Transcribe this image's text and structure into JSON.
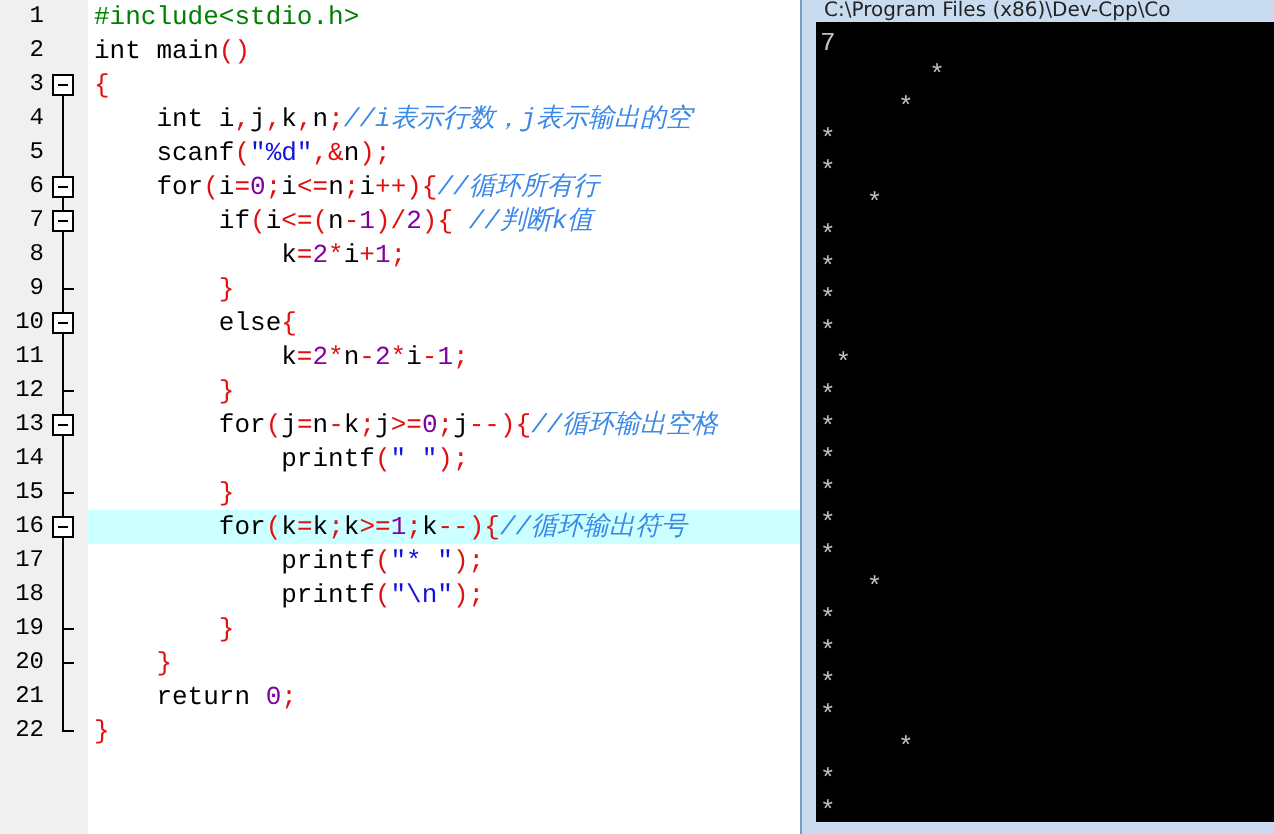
{
  "editor": {
    "lines": [
      {
        "number": "1",
        "kind": "line",
        "current": false,
        "segments": [
          {
            "kind": "pre",
            "text": "#include<stdio.h>"
          }
        ]
      },
      {
        "number": "2",
        "kind": "line",
        "current": false,
        "segments": [
          {
            "kind": "plain",
            "text": "int main"
          },
          {
            "kind": "sym",
            "text": "()"
          }
        ]
      },
      {
        "number": "3",
        "kind": "block_start",
        "current": false,
        "segments": [
          {
            "kind": "sym",
            "text": "{"
          }
        ]
      },
      {
        "number": "4",
        "kind": "line",
        "current": false,
        "segments": [
          {
            "kind": "plain",
            "text": "    int i"
          },
          {
            "kind": "sym",
            "text": ","
          },
          {
            "kind": "plain",
            "text": "j"
          },
          {
            "kind": "sym",
            "text": ","
          },
          {
            "kind": "plain",
            "text": "k"
          },
          {
            "kind": "sym",
            "text": ","
          },
          {
            "kind": "plain",
            "text": "n"
          },
          {
            "kind": "sym",
            "text": ";"
          },
          {
            "kind": "comment",
            "text": "//i表示行数，j表示输出的空"
          }
        ]
      },
      {
        "number": "5",
        "kind": "line",
        "current": false,
        "segments": [
          {
            "kind": "plain",
            "text": "    scanf"
          },
          {
            "kind": "sym",
            "text": "("
          },
          {
            "kind": "str",
            "text": "\"%d\""
          },
          {
            "kind": "sym",
            "text": ",&"
          },
          {
            "kind": "plain",
            "text": "n"
          },
          {
            "kind": "sym",
            "text": ");"
          }
        ]
      },
      {
        "number": "6",
        "kind": "block_start",
        "current": false,
        "segments": [
          {
            "kind": "plain",
            "text": "    for"
          },
          {
            "kind": "sym",
            "text": "("
          },
          {
            "kind": "plain",
            "text": "i"
          },
          {
            "kind": "sym",
            "text": "="
          },
          {
            "kind": "num",
            "text": "0"
          },
          {
            "kind": "sym",
            "text": ";"
          },
          {
            "kind": "plain",
            "text": "i"
          },
          {
            "kind": "sym",
            "text": "<="
          },
          {
            "kind": "plain",
            "text": "n"
          },
          {
            "kind": "sym",
            "text": ";"
          },
          {
            "kind": "plain",
            "text": "i"
          },
          {
            "kind": "sym",
            "text": "++){"
          },
          {
            "kind": "comment",
            "text": "//循环所有行"
          }
        ]
      },
      {
        "number": "7",
        "kind": "block_start",
        "current": false,
        "segments": [
          {
            "kind": "plain",
            "text": "        if"
          },
          {
            "kind": "sym",
            "text": "("
          },
          {
            "kind": "plain",
            "text": "i"
          },
          {
            "kind": "sym",
            "text": "<=("
          },
          {
            "kind": "plain",
            "text": "n"
          },
          {
            "kind": "sym",
            "text": "-"
          },
          {
            "kind": "num",
            "text": "1"
          },
          {
            "kind": "sym",
            "text": ")/"
          },
          {
            "kind": "num",
            "text": "2"
          },
          {
            "kind": "sym",
            "text": "){ "
          },
          {
            "kind": "comment",
            "text": "//判断k值"
          }
        ]
      },
      {
        "number": "8",
        "kind": "line",
        "current": false,
        "segments": [
          {
            "kind": "plain",
            "text": "            k"
          },
          {
            "kind": "sym",
            "text": "="
          },
          {
            "kind": "num",
            "text": "2"
          },
          {
            "kind": "sym",
            "text": "*"
          },
          {
            "kind": "plain",
            "text": "i"
          },
          {
            "kind": "sym",
            "text": "+"
          },
          {
            "kind": "num",
            "text": "1"
          },
          {
            "kind": "sym",
            "text": ";"
          }
        ]
      },
      {
        "number": "9",
        "kind": "block_end",
        "current": false,
        "segments": [
          {
            "kind": "sym",
            "text": "        }"
          }
        ]
      },
      {
        "number": "10",
        "kind": "block_start",
        "current": false,
        "segments": [
          {
            "kind": "plain",
            "text": "        else"
          },
          {
            "kind": "sym",
            "text": "{"
          }
        ]
      },
      {
        "number": "11",
        "kind": "line",
        "current": false,
        "segments": [
          {
            "kind": "plain",
            "text": "            k"
          },
          {
            "kind": "sym",
            "text": "="
          },
          {
            "kind": "num",
            "text": "2"
          },
          {
            "kind": "sym",
            "text": "*"
          },
          {
            "kind": "plain",
            "text": "n"
          },
          {
            "kind": "sym",
            "text": "-"
          },
          {
            "kind": "num",
            "text": "2"
          },
          {
            "kind": "sym",
            "text": "*"
          },
          {
            "kind": "plain",
            "text": "i"
          },
          {
            "kind": "sym",
            "text": "-"
          },
          {
            "kind": "num",
            "text": "1"
          },
          {
            "kind": "sym",
            "text": ";"
          }
        ]
      },
      {
        "number": "12",
        "kind": "block_end",
        "current": false,
        "segments": [
          {
            "kind": "sym",
            "text": "        }"
          }
        ]
      },
      {
        "number": "13",
        "kind": "block_start",
        "current": false,
        "segments": [
          {
            "kind": "plain",
            "text": "        for"
          },
          {
            "kind": "sym",
            "text": "("
          },
          {
            "kind": "plain",
            "text": "j"
          },
          {
            "kind": "sym",
            "text": "="
          },
          {
            "kind": "plain",
            "text": "n"
          },
          {
            "kind": "sym",
            "text": "-"
          },
          {
            "kind": "plain",
            "text": "k"
          },
          {
            "kind": "sym",
            "text": ";"
          },
          {
            "kind": "plain",
            "text": "j"
          },
          {
            "kind": "sym",
            "text": ">="
          },
          {
            "kind": "num",
            "text": "0"
          },
          {
            "kind": "sym",
            "text": ";"
          },
          {
            "kind": "plain",
            "text": "j"
          },
          {
            "kind": "sym",
            "text": "--){"
          },
          {
            "kind": "comment",
            "text": "//循环输出空格"
          }
        ]
      },
      {
        "number": "14",
        "kind": "line",
        "current": false,
        "segments": [
          {
            "kind": "plain",
            "text": "            printf"
          },
          {
            "kind": "sym",
            "text": "("
          },
          {
            "kind": "str",
            "text": "\" \""
          },
          {
            "kind": "sym",
            "text": ");"
          }
        ]
      },
      {
        "number": "15",
        "kind": "block_end",
        "current": false,
        "segments": [
          {
            "kind": "sym",
            "text": "        }"
          }
        ]
      },
      {
        "number": "16",
        "kind": "block_start",
        "current": true,
        "segments": [
          {
            "kind": "plain",
            "text": "        for"
          },
          {
            "kind": "sym",
            "text": "("
          },
          {
            "kind": "plain",
            "text": "k"
          },
          {
            "kind": "sym",
            "text": "="
          },
          {
            "kind": "plain",
            "text": "k"
          },
          {
            "kind": "sym",
            "text": ";"
          },
          {
            "kind": "plain",
            "text": "k"
          },
          {
            "kind": "sym",
            "text": ">="
          },
          {
            "kind": "num",
            "text": "1"
          },
          {
            "kind": "sym",
            "text": ";"
          },
          {
            "kind": "plain",
            "text": "k"
          },
          {
            "kind": "sym",
            "text": "--){"
          },
          {
            "kind": "comment",
            "text": "//循环输出符号"
          }
        ]
      },
      {
        "number": "17",
        "kind": "line",
        "current": false,
        "segments": [
          {
            "kind": "plain",
            "text": "            printf"
          },
          {
            "kind": "sym",
            "text": "("
          },
          {
            "kind": "str",
            "text": "\"* \""
          },
          {
            "kind": "sym",
            "text": ");"
          }
        ]
      },
      {
        "number": "18",
        "kind": "line",
        "current": false,
        "segments": [
          {
            "kind": "plain",
            "text": "            printf"
          },
          {
            "kind": "sym",
            "text": "("
          },
          {
            "kind": "str",
            "text": "\"\\n\""
          },
          {
            "kind": "sym",
            "text": ");"
          }
        ]
      },
      {
        "number": "19",
        "kind": "block_end",
        "current": false,
        "segments": [
          {
            "kind": "sym",
            "text": "        }"
          }
        ]
      },
      {
        "number": "20",
        "kind": "block_end",
        "current": false,
        "segments": [
          {
            "kind": "sym",
            "text": "    }"
          }
        ]
      },
      {
        "number": "21",
        "kind": "line",
        "current": false,
        "segments": [
          {
            "kind": "plain",
            "text": "    return "
          },
          {
            "kind": "num",
            "text": "0"
          },
          {
            "kind": "sym",
            "text": ";"
          }
        ]
      },
      {
        "number": "22",
        "kind": "block_end",
        "current": false,
        "segments": [
          {
            "kind": "sym",
            "text": "}"
          }
        ]
      }
    ]
  },
  "console": {
    "title": "C:\\Program Files (x86)\\Dev-Cpp\\Co",
    "lines": [
      "7",
      "       *",
      "     *",
      "*",
      "*",
      "   *",
      "*",
      "*",
      "*",
      "*",
      " *",
      "*",
      "*",
      "*",
      "*",
      "*",
      "*",
      "   *",
      "*",
      "*",
      "*",
      "*",
      "     *",
      "*",
      "*"
    ]
  }
}
